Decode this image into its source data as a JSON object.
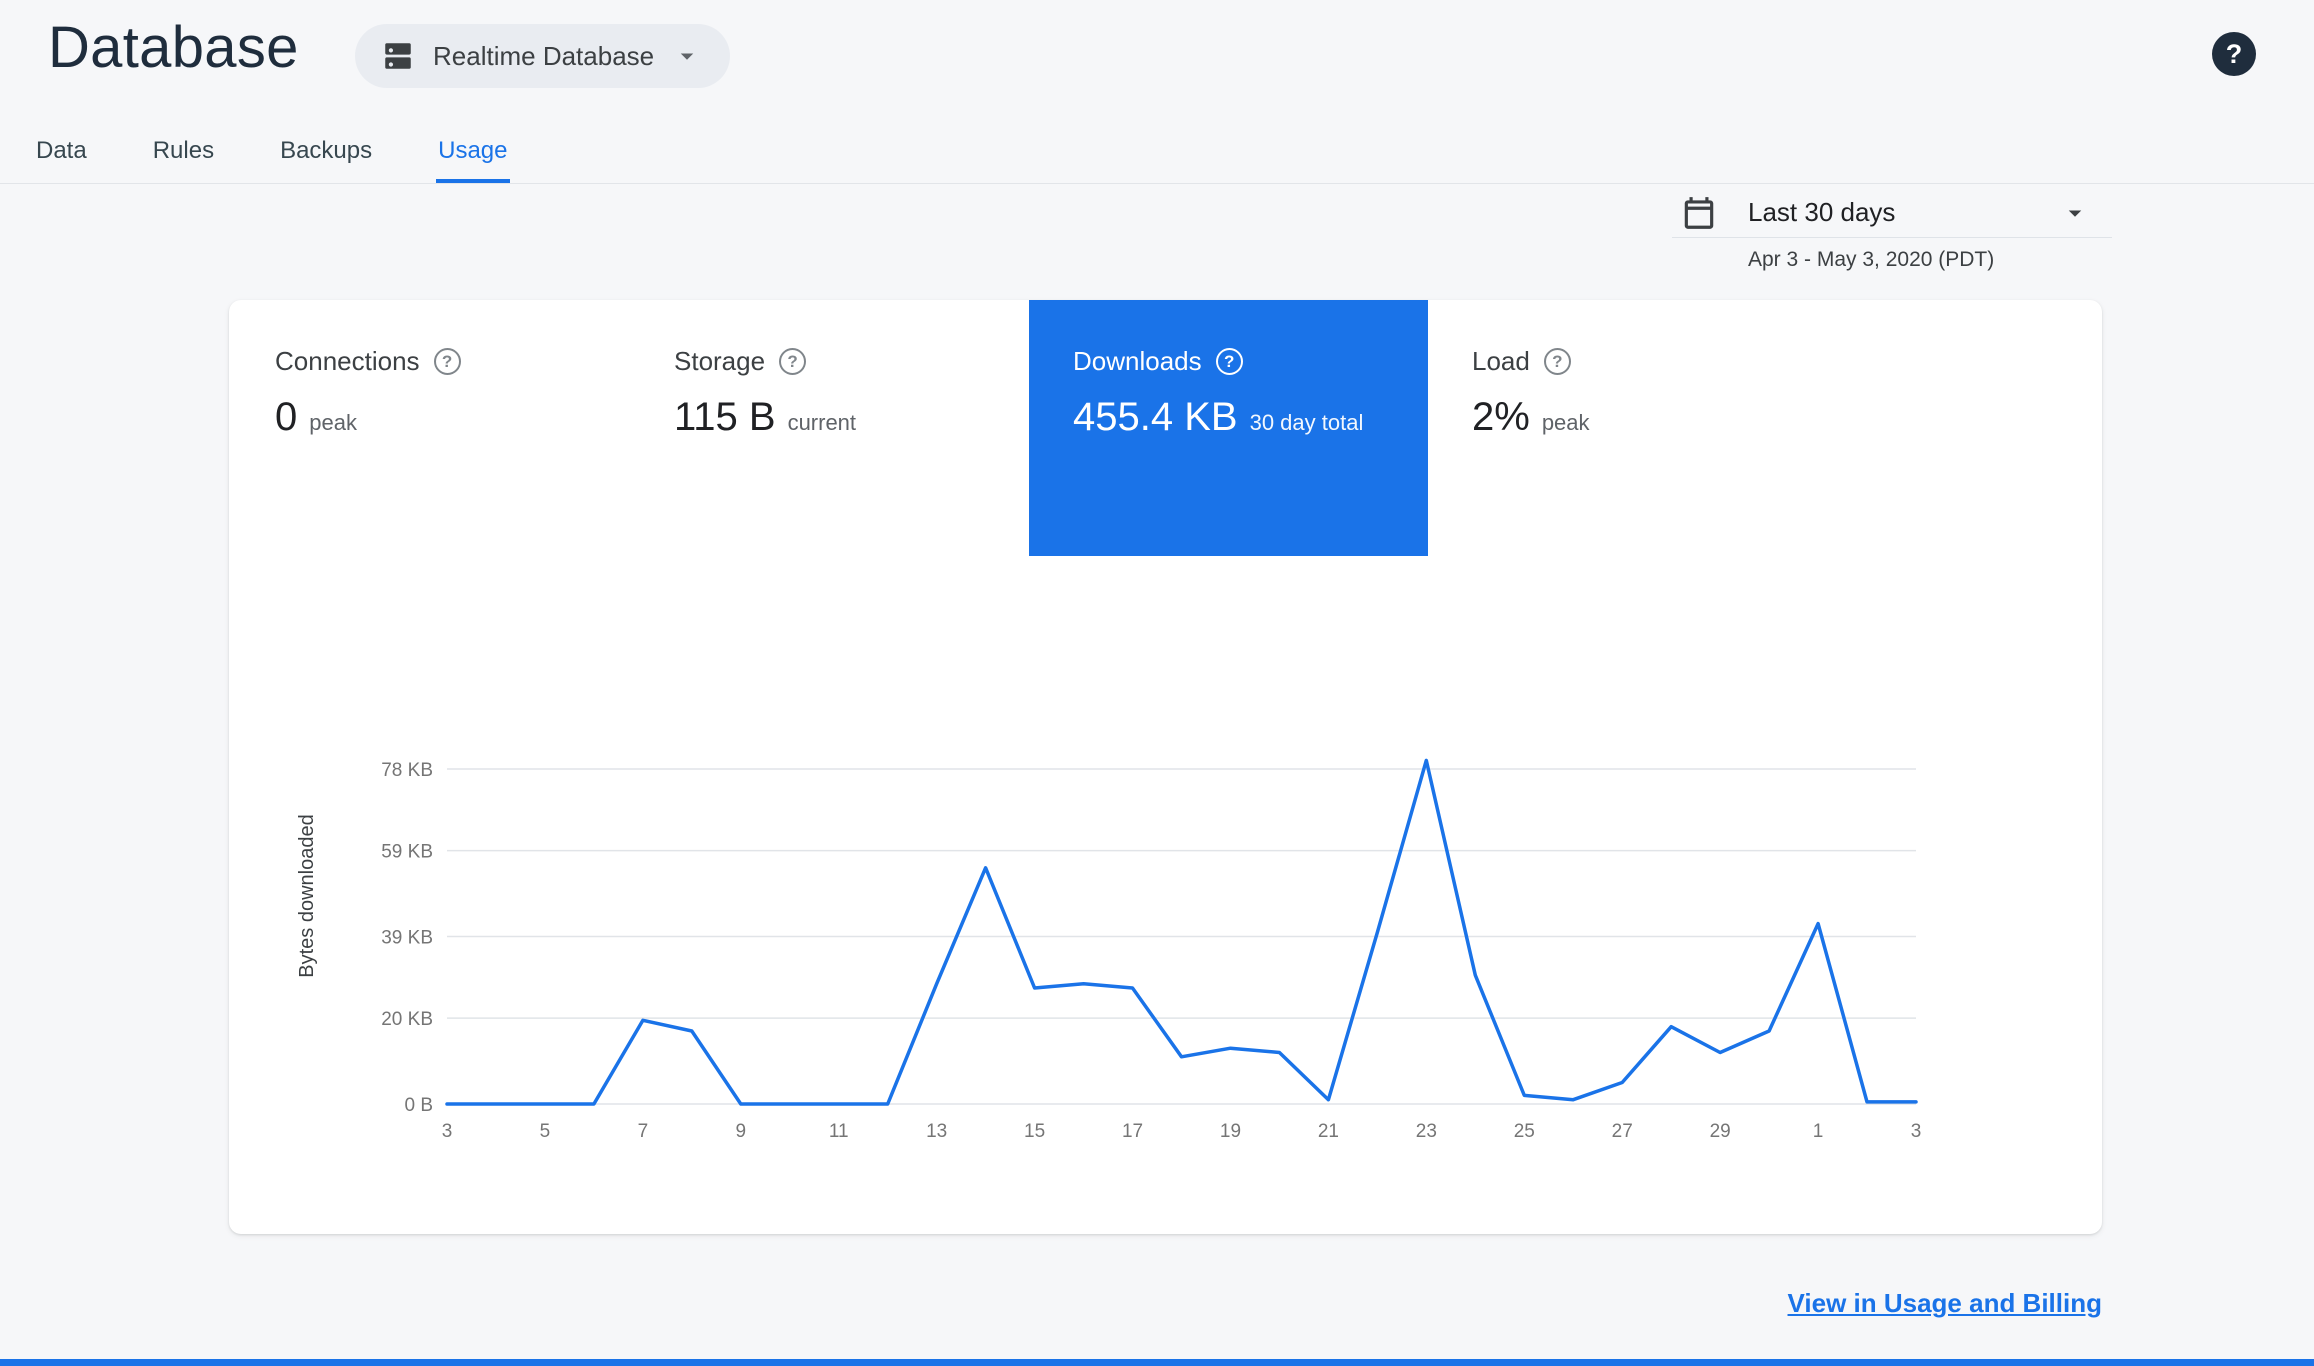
{
  "header": {
    "title": "Database",
    "db_selector_label": "Realtime Database"
  },
  "icons": {
    "help_glyph": "?"
  },
  "tabs": [
    {
      "label": "Data"
    },
    {
      "label": "Rules"
    },
    {
      "label": "Backups"
    },
    {
      "label": "Usage"
    }
  ],
  "date_range": {
    "selected": "Last 30 days",
    "detail": "Apr 3 - May 3, 2020 (PDT)"
  },
  "metrics": [
    {
      "label": "Connections",
      "value": "0",
      "unit": "peak",
      "selected": false
    },
    {
      "label": "Storage",
      "value": "115 B",
      "unit": "current",
      "selected": false
    },
    {
      "label": "Downloads",
      "value": "455.4 KB",
      "unit": "30 day total",
      "selected": true
    },
    {
      "label": "Load",
      "value": "2%",
      "unit": "peak",
      "selected": false
    }
  ],
  "chart_data": {
    "type": "line",
    "title": "",
    "ylabel": "Bytes downloaded",
    "xlabel": "",
    "unit": "KB",
    "grid": true,
    "legend": false,
    "line_color": "#1a73e8",
    "days": [
      3,
      4,
      5,
      6,
      7,
      8,
      9,
      10,
      11,
      12,
      13,
      14,
      15,
      16,
      17,
      18,
      19,
      20,
      21,
      22,
      23,
      24,
      25,
      26,
      27,
      28,
      29,
      30,
      1,
      2,
      3
    ],
    "values_kb": [
      0,
      0,
      0,
      0,
      19.5,
      17,
      0,
      0,
      0,
      0,
      28,
      55,
      27,
      28,
      27,
      11,
      13,
      12,
      1,
      40,
      80,
      30,
      2,
      1,
      5,
      18,
      12,
      17,
      42,
      0.5,
      0.5
    ],
    "x_tick_labels": [
      "3",
      "5",
      "7",
      "9",
      "11",
      "13",
      "15",
      "17",
      "19",
      "21",
      "23",
      "25",
      "27",
      "29",
      "1",
      "3"
    ],
    "y_ticks_kb": [
      0,
      20,
      39,
      59,
      78
    ],
    "y_tick_labels": [
      "0 B",
      "20 KB",
      "39 KB",
      "59 KB",
      "78 KB"
    ],
    "ylim_kb": [
      0,
      86
    ],
    "total_30_day": "455.4 KB"
  },
  "footer": {
    "billing_link": "View in Usage and Billing"
  },
  "colors": {
    "accent": "#1a73e8",
    "selected_tile_bg": "#1a73e8",
    "page_bg": "#f6f7f9",
    "card_bg": "#ffffff",
    "grid_line": "#e1e4e8",
    "tick_text": "#757575"
  }
}
